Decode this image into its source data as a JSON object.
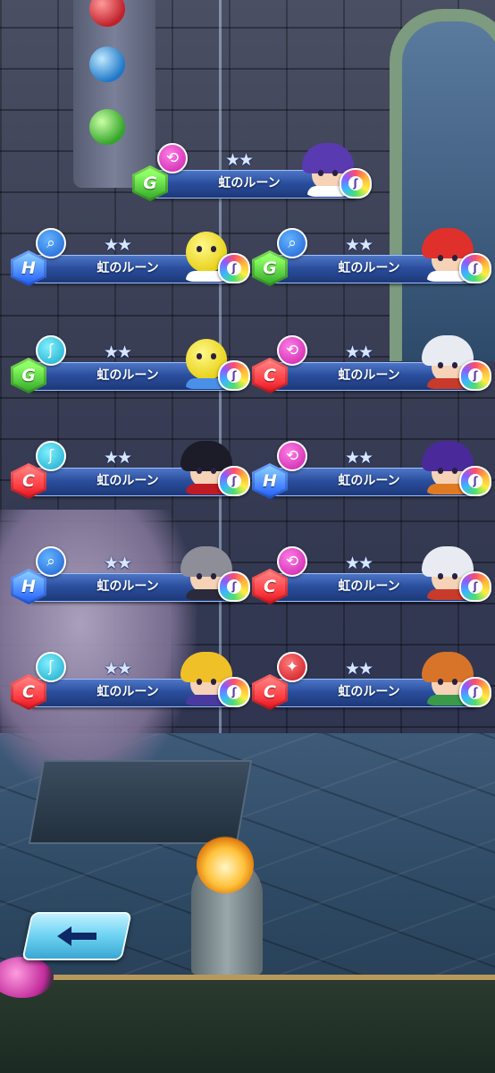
{
  "screen": {
    "back_button_label": "back-arrow-icon"
  },
  "runes": [
    {
      "id": "r1",
      "name": "虹のルーン",
      "stars": "★★",
      "grade": "G",
      "skill": "spin",
      "skill_color": "pink",
      "skill_glyph": "⟲",
      "character": "purple-hair",
      "hair": "#5a3ab0",
      "shirt": "#ffffff",
      "ball": false
    },
    {
      "id": "r2",
      "name": "虹のルーン",
      "stars": "★★",
      "grade": "H",
      "skill": "racket",
      "skill_color": "blue",
      "skill_glyph": "⌕",
      "character": "tennis-ball-mascot",
      "hair": "#1a2a4a",
      "shirt": "#ffffff",
      "ball": true
    },
    {
      "id": "r3",
      "name": "虹のルーン",
      "stars": "★★",
      "grade": "G",
      "skill": "racket",
      "skill_color": "blue",
      "skill_glyph": "⌕",
      "character": "red-ponytail",
      "hair": "#e0302c",
      "shirt": "#ffffff",
      "ball": false
    },
    {
      "id": "r4",
      "name": "虹のルーン",
      "stars": "★★",
      "grade": "G",
      "skill": "shoe",
      "skill_color": "cyan",
      "skill_glyph": "ʃ",
      "character": "tennis-ball-mascot-cap",
      "hair": "#ffffff",
      "shirt": "#4a8fe8",
      "ball": true
    },
    {
      "id": "r5",
      "name": "虹のルーン",
      "stars": "★★",
      "grade": "C",
      "skill": "spin",
      "skill_color": "pink",
      "skill_glyph": "⟲",
      "character": "white-hair-cat-ears",
      "hair": "#e8ecf2",
      "shirt": "#c83a2a",
      "ball": false
    },
    {
      "id": "r6",
      "name": "虹のルーン",
      "stars": "★★",
      "grade": "C",
      "skill": "shoe",
      "skill_color": "cyan",
      "skill_glyph": "ʃ",
      "character": "black-hair-cat-ears",
      "hair": "#1c1c28",
      "shirt": "#c01a24",
      "ball": false
    },
    {
      "id": "r7",
      "name": "虹のルーン",
      "stars": "★★",
      "grade": "H",
      "skill": "spin",
      "skill_color": "pink",
      "skill_glyph": "⟲",
      "character": "purple-beanie",
      "hair": "#4a2a9a",
      "shirt": "#e07a22",
      "ball": false
    },
    {
      "id": "r8",
      "name": "虹のルーン",
      "stars": "★★",
      "grade": "H",
      "skill": "racket",
      "skill_color": "blue",
      "skill_glyph": "⌕",
      "character": "gray-hair-headband",
      "hair": "#8e8e98",
      "shirt": "#2a2a3a",
      "ball": false
    },
    {
      "id": "r9",
      "name": "虹のルーン",
      "stars": "★★",
      "grade": "C",
      "skill": "spin",
      "skill_color": "pink",
      "skill_glyph": "⟲",
      "character": "white-hair-cat-ears",
      "hair": "#e8ecf2",
      "shirt": "#c83a2a",
      "ball": false
    },
    {
      "id": "r10",
      "name": "虹のルーン",
      "stars": "★★",
      "grade": "C",
      "skill": "shoe",
      "skill_color": "cyan",
      "skill_glyph": "ʃ",
      "character": "blonde-spiky",
      "hair": "#f0c028",
      "shirt": "#4a3aa0",
      "ball": false
    },
    {
      "id": "r11",
      "name": "虹のルーン",
      "stars": "★★",
      "grade": "C",
      "skill": "smash",
      "skill_color": "red",
      "skill_glyph": "✦",
      "character": "orange-hair-fox-ears",
      "hair": "#d8742a",
      "shirt": "#3a9a4a",
      "ball": false
    }
  ]
}
